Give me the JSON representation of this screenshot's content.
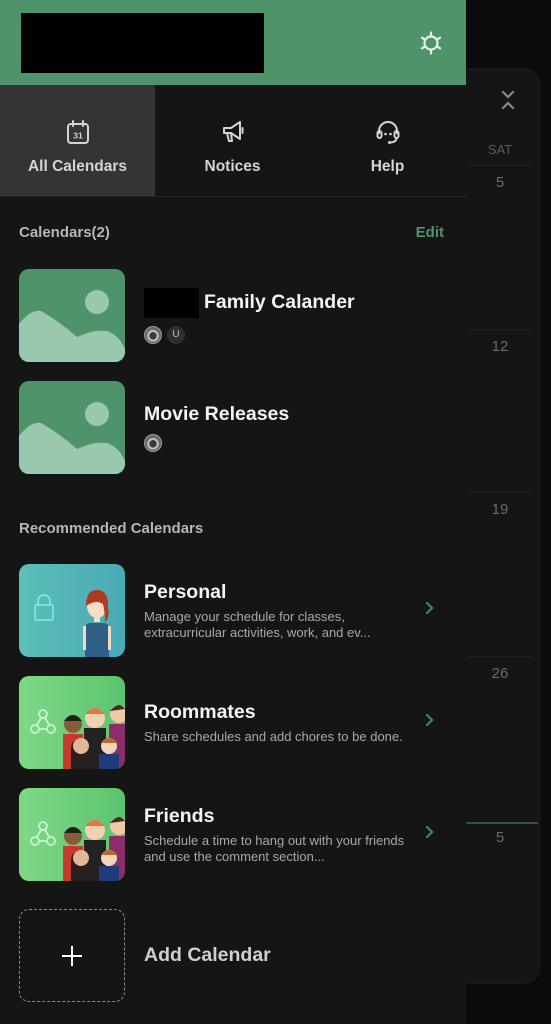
{
  "header": {
    "settings_icon": "gear-icon"
  },
  "tabs": [
    {
      "label": "All Calendars",
      "icon": "calendar-31-icon",
      "active": true
    },
    {
      "label": "Notices",
      "icon": "megaphone-icon",
      "active": false
    },
    {
      "label": "Help",
      "icon": "headset-icon",
      "active": false
    }
  ],
  "calendars": {
    "title": "Calendars(2)",
    "edit_label": "Edit",
    "items": [
      {
        "name": "Family Calander",
        "name_prefix_redacted": true,
        "members": [
          "photo",
          "U"
        ]
      },
      {
        "name": "Movie Releases",
        "name_prefix_redacted": false,
        "members": [
          "photo"
        ]
      }
    ]
  },
  "recommended": {
    "title": "Recommended Calendars",
    "items": [
      {
        "name": "Personal",
        "description": "Manage your schedule for classes, extracurricular activities, work, and ev..."
      },
      {
        "name": "Roommates",
        "description": "Share schedules and add chores to be done."
      },
      {
        "name": "Friends",
        "description": "Schedule a time to hang out with your friends and use the comment section..."
      }
    ]
  },
  "add_calendar": {
    "label": "Add Calendar"
  },
  "background_calendar": {
    "day_header": "SAT",
    "days": [
      "5",
      "12",
      "19",
      "26",
      "5"
    ]
  },
  "colors": {
    "accent": "#4e936a",
    "drawer_bg": "#151515",
    "active_tab_bg": "#343434"
  }
}
